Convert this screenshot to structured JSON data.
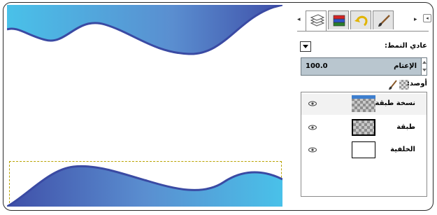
{
  "canvas": {
    "wave_colors": {
      "light": "#49c1e9",
      "mid": "#5a8ed0",
      "dark": "#3f4fa8",
      "edge": "#3a4aa3"
    },
    "selection_color": "#b8a200"
  },
  "layers_panel": {
    "tabs": [
      {
        "icon": "layers-icon",
        "active": true
      },
      {
        "icon": "channels-icon",
        "active": false
      },
      {
        "icon": "undo-history-icon",
        "active": false
      },
      {
        "icon": "brushes-icon",
        "active": false
      }
    ],
    "mode_label": "عادي النمط:",
    "opacity_label": "الإعتام",
    "opacity_value": "100.0",
    "lock_label": "أوصد:",
    "layers": [
      {
        "name": "نسخة طبقة",
        "visible": true,
        "selected": true,
        "thumbnail": "transparent-with-blue-top"
      },
      {
        "name": "طبقة",
        "visible": true,
        "selected": false,
        "thumbnail": "transparent-boxed"
      },
      {
        "name": "الخلفية",
        "visible": true,
        "selected": false,
        "thumbnail": "white"
      }
    ]
  }
}
